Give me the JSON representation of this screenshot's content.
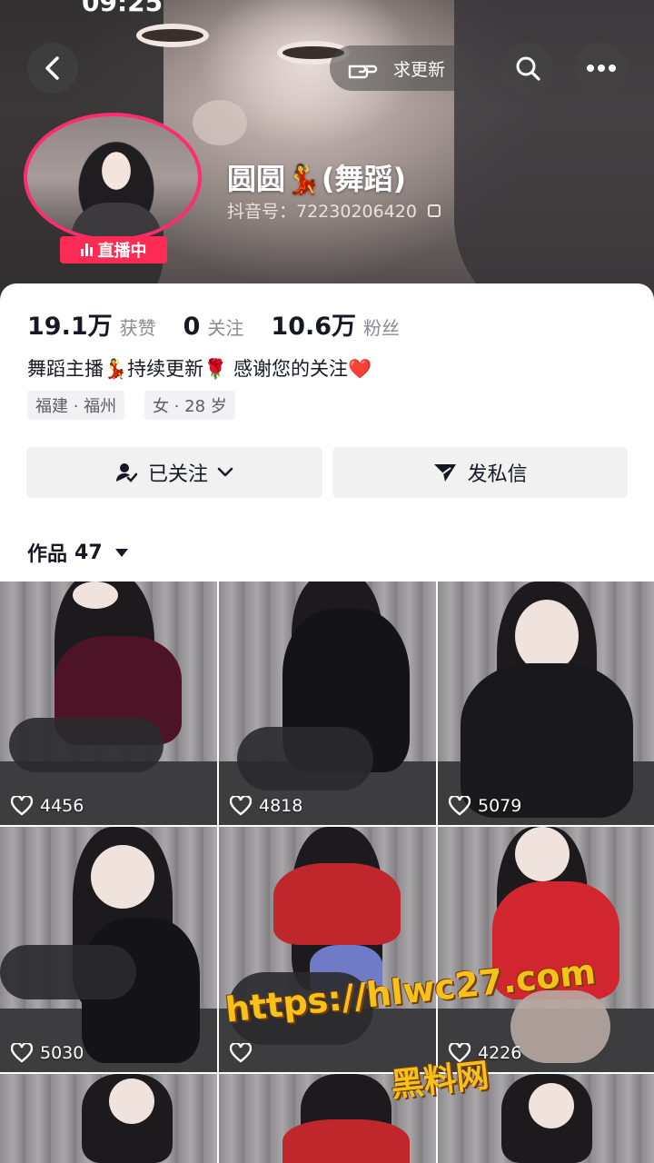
{
  "status_bar": {
    "time": "09:25"
  },
  "top_nav": {
    "back_icon": "chevron-left-icon",
    "update_label": "求更新",
    "update_icon": "pointing-hand-icon",
    "search_icon": "search-icon",
    "more_icon": "more-dots-icon"
  },
  "profile": {
    "nickname": "圆圆💃(舞蹈)",
    "douyin_id": "抖音号：72230206420",
    "live_label": "直播中",
    "avatar_ring_color": "#fe2c55"
  },
  "stats": [
    {
      "value": "19.1万",
      "label": "获赞"
    },
    {
      "value": "0",
      "label": "关注"
    },
    {
      "value": "10.6万",
      "label": "粉丝"
    }
  ],
  "bio": "舞蹈主播💃持续更新🌹 感谢您的关注❤️",
  "tags": {
    "location": "福建 · 福州",
    "info": "女 · 28 岁"
  },
  "actions": {
    "follow_label": "已关注",
    "message_label": "发私信"
  },
  "works": {
    "label": "作品",
    "count": "47"
  },
  "videos": [
    {
      "likes": "4456"
    },
    {
      "likes": "4818"
    },
    {
      "likes": "5079"
    },
    {
      "likes": "5030"
    },
    {
      "likes": ""
    },
    {
      "likes": "4226"
    }
  ],
  "watermark": {
    "line1": "https://hlwc27.com",
    "line2": "黑料网"
  },
  "colors": {
    "accent": "#fe2c55",
    "text": "#161823",
    "secondary": "#8a8b91",
    "watermark": "#f5c21b"
  }
}
